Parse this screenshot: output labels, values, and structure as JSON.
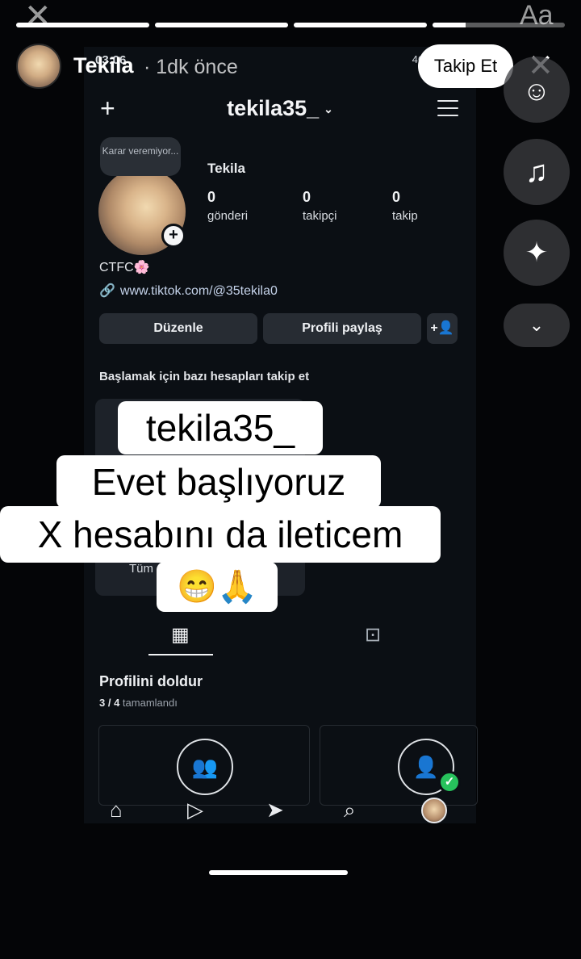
{
  "story": {
    "username": "Tekila",
    "time": "· 1dk önce",
    "follow_label": "Takip Et",
    "close_icon": "✕",
    "ghost_close": "✕",
    "ghost_text_tool": "Aa",
    "progress": [
      1,
      1,
      1,
      0.25
    ]
  },
  "side_tools": {
    "sticker_icon": "sticker-icon",
    "music_icon": "music-icon",
    "sparkle_icon": "sparkle-icon",
    "more_icon": "chevron-down-icon"
  },
  "screenshot": {
    "status_time": "03:06",
    "status_signal": "4G",
    "header": {
      "username": "tekila35_",
      "chevron": "⌄",
      "plus": "+"
    },
    "note": "Karar veremiyor...",
    "profile_name": "Tekila",
    "stats": [
      {
        "value": "0",
        "label": "gönderi"
      },
      {
        "value": "0",
        "label": "takipçi"
      },
      {
        "value": "0",
        "label": "takip"
      }
    ],
    "bio": "CTFC🌸",
    "link": "www.tiktok.com/@35tekila0",
    "buttons": {
      "edit": "Düzenle",
      "share": "Profili paylaş",
      "add_user": "+👤"
    },
    "suggest_title": "Başlamak için bazı hesapları takip et",
    "suggest_partial": "Tüm",
    "fill_title": "Profilini doldur",
    "fill_progress_count": "3 / 4",
    "fill_progress_label": "tamamlandı"
  },
  "overlay_text": {
    "line1": "tekila35_",
    "line2": "Evet başlıyoruz",
    "line3": "X hesabını da ileticem",
    "line4": "😁🙏"
  }
}
